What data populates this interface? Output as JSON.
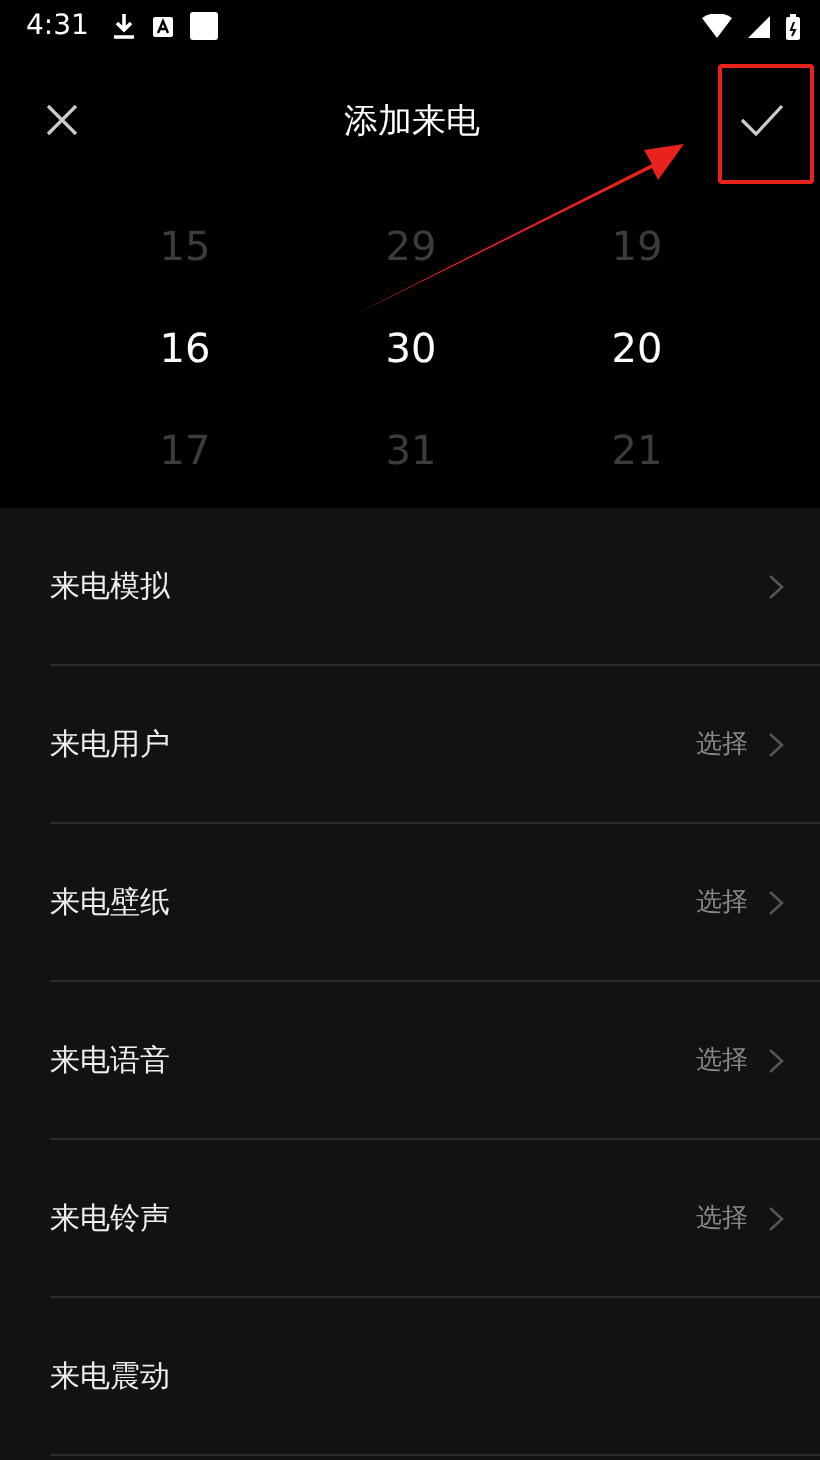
{
  "status_bar": {
    "time": "4:31"
  },
  "header": {
    "title": "添加来电"
  },
  "picker": {
    "columns": [
      {
        "items": [
          {
            "text": "15",
            "selected": false
          },
          {
            "text": "16",
            "selected": true
          },
          {
            "text": "17",
            "selected": false
          }
        ]
      },
      {
        "items": [
          {
            "text": "29",
            "selected": false
          },
          {
            "text": "30",
            "selected": true
          },
          {
            "text": "31",
            "selected": false
          }
        ]
      },
      {
        "items": [
          {
            "text": "19",
            "selected": false
          },
          {
            "text": "20",
            "selected": true
          },
          {
            "text": "21",
            "selected": false
          }
        ]
      }
    ]
  },
  "settings": [
    {
      "label": "来电模拟",
      "chevron": true
    },
    {
      "label": "来电用户",
      "value": "选择",
      "chevron": true
    },
    {
      "label": "来电壁纸",
      "value": "选择",
      "chevron": true
    },
    {
      "label": "来电语音",
      "value": "选择",
      "chevron": true
    },
    {
      "label": "来电铃声",
      "value": "选择",
      "chevron": true
    },
    {
      "label": "来电震动",
      "chevron": false
    }
  ],
  "annotations": {
    "highlight_box": true,
    "arrow": true
  }
}
